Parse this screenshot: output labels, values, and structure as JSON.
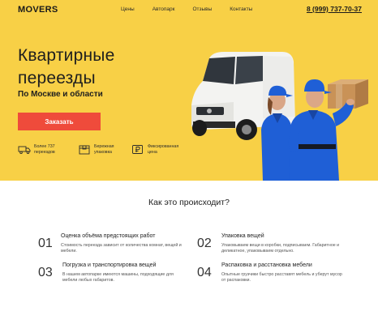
{
  "nav": {
    "logo": "MOVERS",
    "links": [
      "Цены",
      "Автопарк",
      "Отзывы",
      "Контакты"
    ],
    "phone": "8 (999) 737-70-37"
  },
  "hero": {
    "title_line1": "Квартирные",
    "title_line2": "переезды",
    "subtitle": "По Москве и области",
    "cta_label": "Заказать",
    "features": [
      {
        "icon": "truck-icon",
        "line1": "Более 737",
        "line2": "переездов"
      },
      {
        "icon": "box-icon",
        "line1": "Бережная",
        "line2": "упаковка"
      },
      {
        "icon": "ruble-icon",
        "line1": "Фиксированная",
        "line2": "цена"
      }
    ]
  },
  "process": {
    "title": "Как это происходит?",
    "steps": [
      {
        "num": "01",
        "title": "Оценка объёма предстоящих работ",
        "desc": "Стоимость переезда зависит от количества комнат, вещей и мебели."
      },
      {
        "num": "02",
        "title": "Упаковка вещей",
        "desc": "Упаковываем вещи в коробки, подписываем. Габаритное и деликатное, упаковываем отдельно."
      },
      {
        "num": "03",
        "title": "Погрузка и транспортировка вещей",
        "desc": "В нашем автопарке имеются машины, подходящие для мебели любых габаритов."
      },
      {
        "num": "04",
        "title": "Распаковка и расстановка мебели",
        "desc": "Опытные грузчики быстро расставят мебель и уберут мусор от распаковки."
      }
    ]
  },
  "colors": {
    "accent_yellow": "#f8d046",
    "cta_red": "#ef4b3b",
    "uniform_blue": "#1f5fd6"
  }
}
